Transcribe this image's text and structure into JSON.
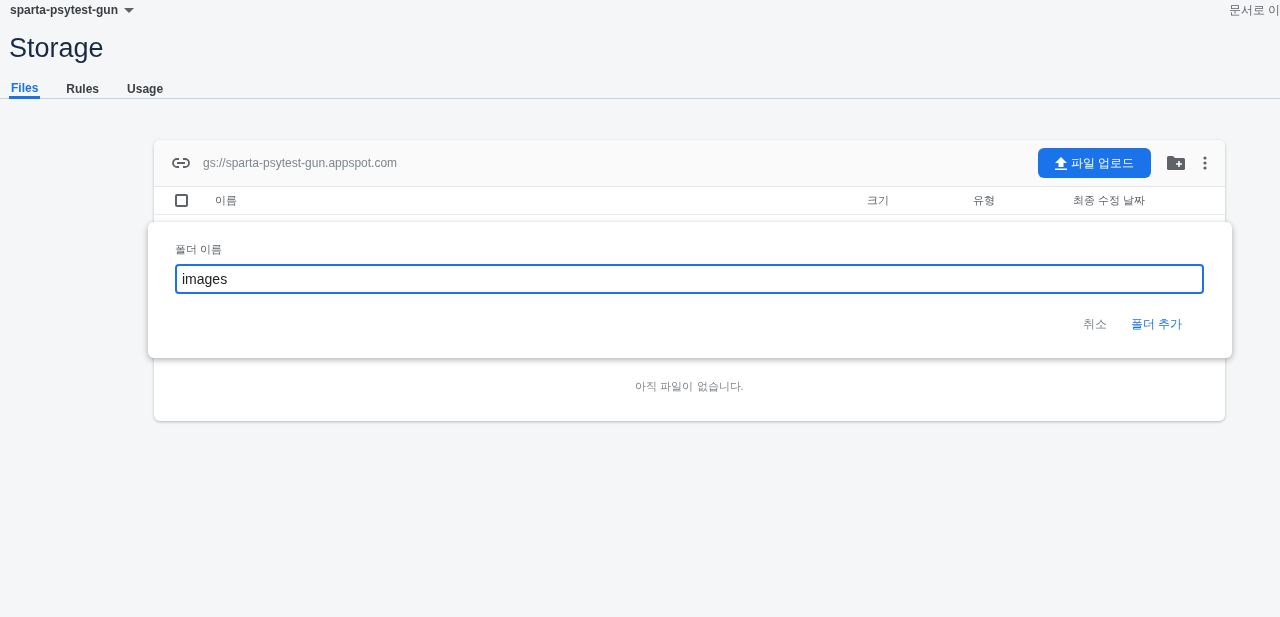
{
  "project": {
    "name": "sparta-psytest-gun"
  },
  "docs_link": "문서로 이",
  "page_title": "Storage",
  "tabs": [
    {
      "label": "Files",
      "selected": true
    },
    {
      "label": "Rules",
      "selected": false
    },
    {
      "label": "Usage",
      "selected": false
    }
  ],
  "bucket": {
    "url": "gs://sparta-psytest-gun.appspot.com",
    "upload_button": "파일 업로드"
  },
  "table": {
    "select_all": {
      "checked": false
    },
    "columns": [
      "이름",
      "크기",
      "유형",
      "최종 수정 날짜"
    ],
    "empty_message": "아직 파일이 없습니다."
  },
  "dialog": {
    "field_label": "폴더 이름",
    "value": "images",
    "buttons": [
      {
        "label": "취소",
        "kind": "secondary"
      },
      {
        "label": "폴더 추가",
        "kind": "primary"
      }
    ]
  }
}
